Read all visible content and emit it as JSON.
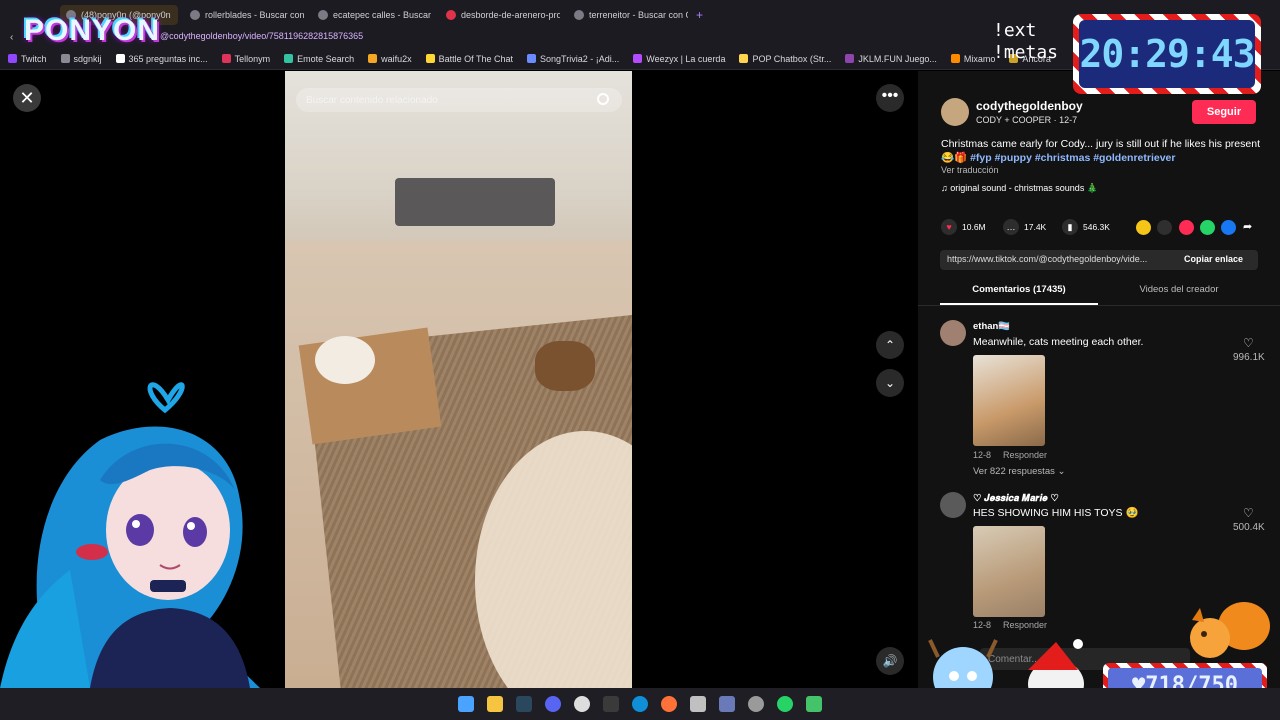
{
  "browser": {
    "tabs": [
      {
        "label": "(48)pony0n (@pony0n"
      },
      {
        "label": "rollerblades - Buscar con"
      },
      {
        "label": "ecatepec calles - Buscar c"
      },
      {
        "label": "desborde-de-arenero-pro"
      },
      {
        "label": "terreneitor - Buscar con G"
      }
    ],
    "url": "@codythegoldenboy/video/7581196282815876365",
    "bookmarks": [
      {
        "label": "Twitch"
      },
      {
        "label": "sdgnkij"
      },
      {
        "label": "365 preguntas inc..."
      },
      {
        "label": "Tellonym"
      },
      {
        "label": "Emote Search"
      },
      {
        "label": "waifu2x"
      },
      {
        "label": "Battle Of The Chat"
      },
      {
        "label": "SongTrivia2 - ¡Adi..."
      },
      {
        "label": "Weezyx | La cuerda"
      },
      {
        "label": "POP Chatbox (Str..."
      },
      {
        "label": "JKLM.FUN Juego..."
      },
      {
        "label": "Mixamo"
      },
      {
        "label": "Ancora"
      }
    ]
  },
  "overlay": {
    "logo": "PONYON",
    "commands": [
      "!ext",
      "!metas"
    ],
    "clock": "20:29:43",
    "counter": "♥718/750"
  },
  "video": {
    "search_placeholder": "Buscar contenido relacionado",
    "close_glyph": "✕",
    "more_glyph": "•••",
    "up_glyph": "⌃",
    "down_glyph": "⌄",
    "volume_glyph": "🔊"
  },
  "post": {
    "username": "codythegoldenboy",
    "subline": "CODY + COOPER · 12-7",
    "follow": "Seguir",
    "caption_text": "Christmas came early for Cody... jury is still out if he likes his present 😂🎁 ",
    "hashtags": "#fyp #puppy #christmas #goldenretriever",
    "translate": "Ver traducción",
    "sound": "♫  original sound - christmas sounds 🎄",
    "likes": "10.6M",
    "comments": "17.4K",
    "saves": "546.3K",
    "link": "https://www.tiktok.com/@codythegoldenboy/vide...",
    "copy": "Copiar enlace",
    "tab_comments": "Comentarios (17435)",
    "tab_videos": "Videos del creador"
  },
  "comments": [
    {
      "name": "ethan🏳️‍⚧️",
      "text": "Meanwhile, cats meeting each other.",
      "date": "12-8",
      "reply": "Responder",
      "likes": "996.1K",
      "replies": "Ver 822 respuestas ⌄"
    },
    {
      "name": "♡ 𝑱𝒆𝒔𝒔𝒊𝒄𝒂 𝑴𝒂𝒓𝒊𝒆 ♡",
      "text": "HES SHOWING HIM HIS TOYS 🥹",
      "date": "12-8",
      "reply": "Responder",
      "likes": "500.4K"
    }
  ],
  "comment_input_placeholder": "Comentar..."
}
